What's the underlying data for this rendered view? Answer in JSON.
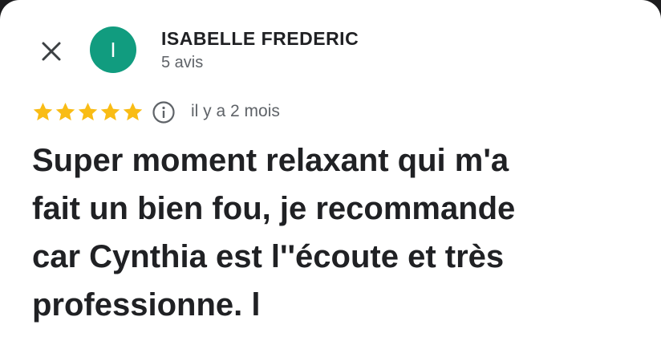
{
  "header": {
    "close_icon": "close-icon"
  },
  "author": {
    "initial": "I",
    "avatar_color": "#119c7f",
    "name": "ISABELLE FREDERIC",
    "meta": "5 avis"
  },
  "review": {
    "rating": 5,
    "rating_max": 5,
    "star_color": "#f9bc15",
    "info_icon": "info-icon",
    "date": "il y a 2 mois",
    "lines": [
      "Super moment relaxant qui m'a",
      "fait un bien fou, je recommande",
      "car Cynthia est l''écoute et très",
      "professionne. l"
    ]
  }
}
